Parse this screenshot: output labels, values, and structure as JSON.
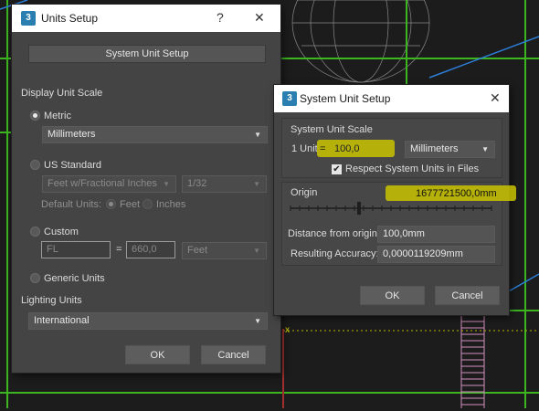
{
  "units_setup": {
    "title": "Units Setup",
    "help_label": "?",
    "close_label": "✕",
    "system_unit_setup_button": "System Unit Setup",
    "display_unit_scale_label": "Display Unit Scale",
    "metric": {
      "label": "Metric",
      "selected": true,
      "dropdown_value": "Millimeters"
    },
    "us_standard": {
      "label": "US Standard",
      "dropdown_value": "Feet w/Fractional Inches",
      "fraction_value": "1/32",
      "default_units_label": "Default Units:",
      "feet_label": "Feet",
      "inches_label": "Inches"
    },
    "custom": {
      "label": "Custom",
      "name_value": "FL",
      "equals": "=",
      "amount_value": "660,0",
      "unit_value": "Feet"
    },
    "generic": {
      "label": "Generic Units"
    },
    "lighting_units_label": "Lighting Units",
    "lighting_units_value": "International",
    "ok_label": "OK",
    "cancel_label": "Cancel"
  },
  "system_unit_setup": {
    "title": "System Unit Setup",
    "close_label": "✕",
    "scale_label": "System Unit Scale",
    "one_unit_label": "1 Unit",
    "equals": "=",
    "unit_value": "100,0",
    "unit_type": "Millimeters",
    "respect_label": "Respect System Units in Files",
    "respect_checked": true,
    "origin_label": "Origin",
    "origin_value": "1677721500,0mm",
    "distance_label": "Distance from origin:",
    "distance_value": "100,0mm",
    "accuracy_label": "Resulting Accuracy:",
    "accuracy_value": "0,0000119209mm",
    "ok_label": "OK",
    "cancel_label": "Cancel"
  },
  "viewport": {
    "axis_label": "x"
  },
  "colors": {
    "accent_highlight": "#c9c400",
    "window_bg": "#444444",
    "grid_green": "#3cb521",
    "grid_blue": "#2c7fd9"
  }
}
